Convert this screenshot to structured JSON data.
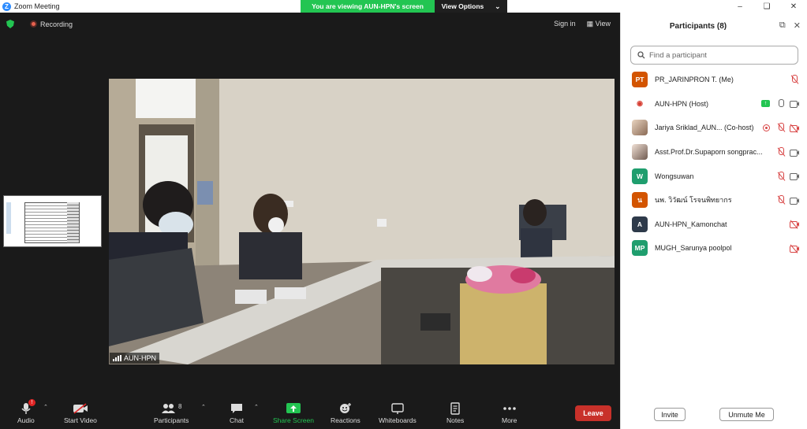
{
  "window": {
    "title": "Zoom Meeting"
  },
  "share_banner": {
    "viewing_text": "You are viewing AUN-HPN's screen",
    "view_options_label": "View Options"
  },
  "meeting": {
    "recording_label": "Recording",
    "sign_in_label": "Sign in",
    "view_label": "View",
    "video_label": "AUN-HPN"
  },
  "toolbar": {
    "audio_label": "Audio",
    "audio_badge": "!",
    "start_video_label": "Start Video",
    "participants_label": "Participants",
    "participants_count": "8",
    "chat_label": "Chat",
    "share_screen_label": "Share Screen",
    "reactions_label": "Reactions",
    "whiteboards_label": "Whiteboards",
    "notes_label": "Notes",
    "more_label": "More",
    "leave_label": "Leave"
  },
  "panel": {
    "title": "Participants (8)",
    "search_placeholder": "Find a participant",
    "invite_label": "Invite",
    "unmute_me_label": "Unmute Me",
    "participants": [
      {
        "initials": "PT",
        "name": "PR_JARINPRON T. (Me)",
        "color": "#d35400",
        "mic": "off",
        "cam": "none"
      },
      {
        "initials": "",
        "name": "AUN-HPN (Host)",
        "color": "#ffffff",
        "mic": "on",
        "cam": "on",
        "sharing": true
      },
      {
        "initials": "",
        "name": "Jariya Sriklad_AUN... (Co-host)",
        "color": "#b08060",
        "mic": "off",
        "cam": "off",
        "recording": true
      },
      {
        "initials": "",
        "name": "Asst.Prof.Dr.Supaporn songprac...",
        "color": "#9a8070",
        "mic": "off",
        "cam": "on"
      },
      {
        "initials": "W",
        "name": "Wongsuwan",
        "color": "#1f9e6e",
        "mic": "off",
        "cam": "on"
      },
      {
        "initials": "น",
        "name": "นพ. วิวัฒน์ โรจนพิทยากร",
        "color": "#d35400",
        "mic": "off",
        "cam": "on"
      },
      {
        "initials": "A",
        "name": "AUN-HPN_Kamonchat",
        "color": "#2e3a4a",
        "mic": "none",
        "cam": "off"
      },
      {
        "initials": "MP",
        "name": "MUGH_Sarunya poolpol",
        "color": "#1f9e6e",
        "mic": "none",
        "cam": "off"
      }
    ]
  }
}
